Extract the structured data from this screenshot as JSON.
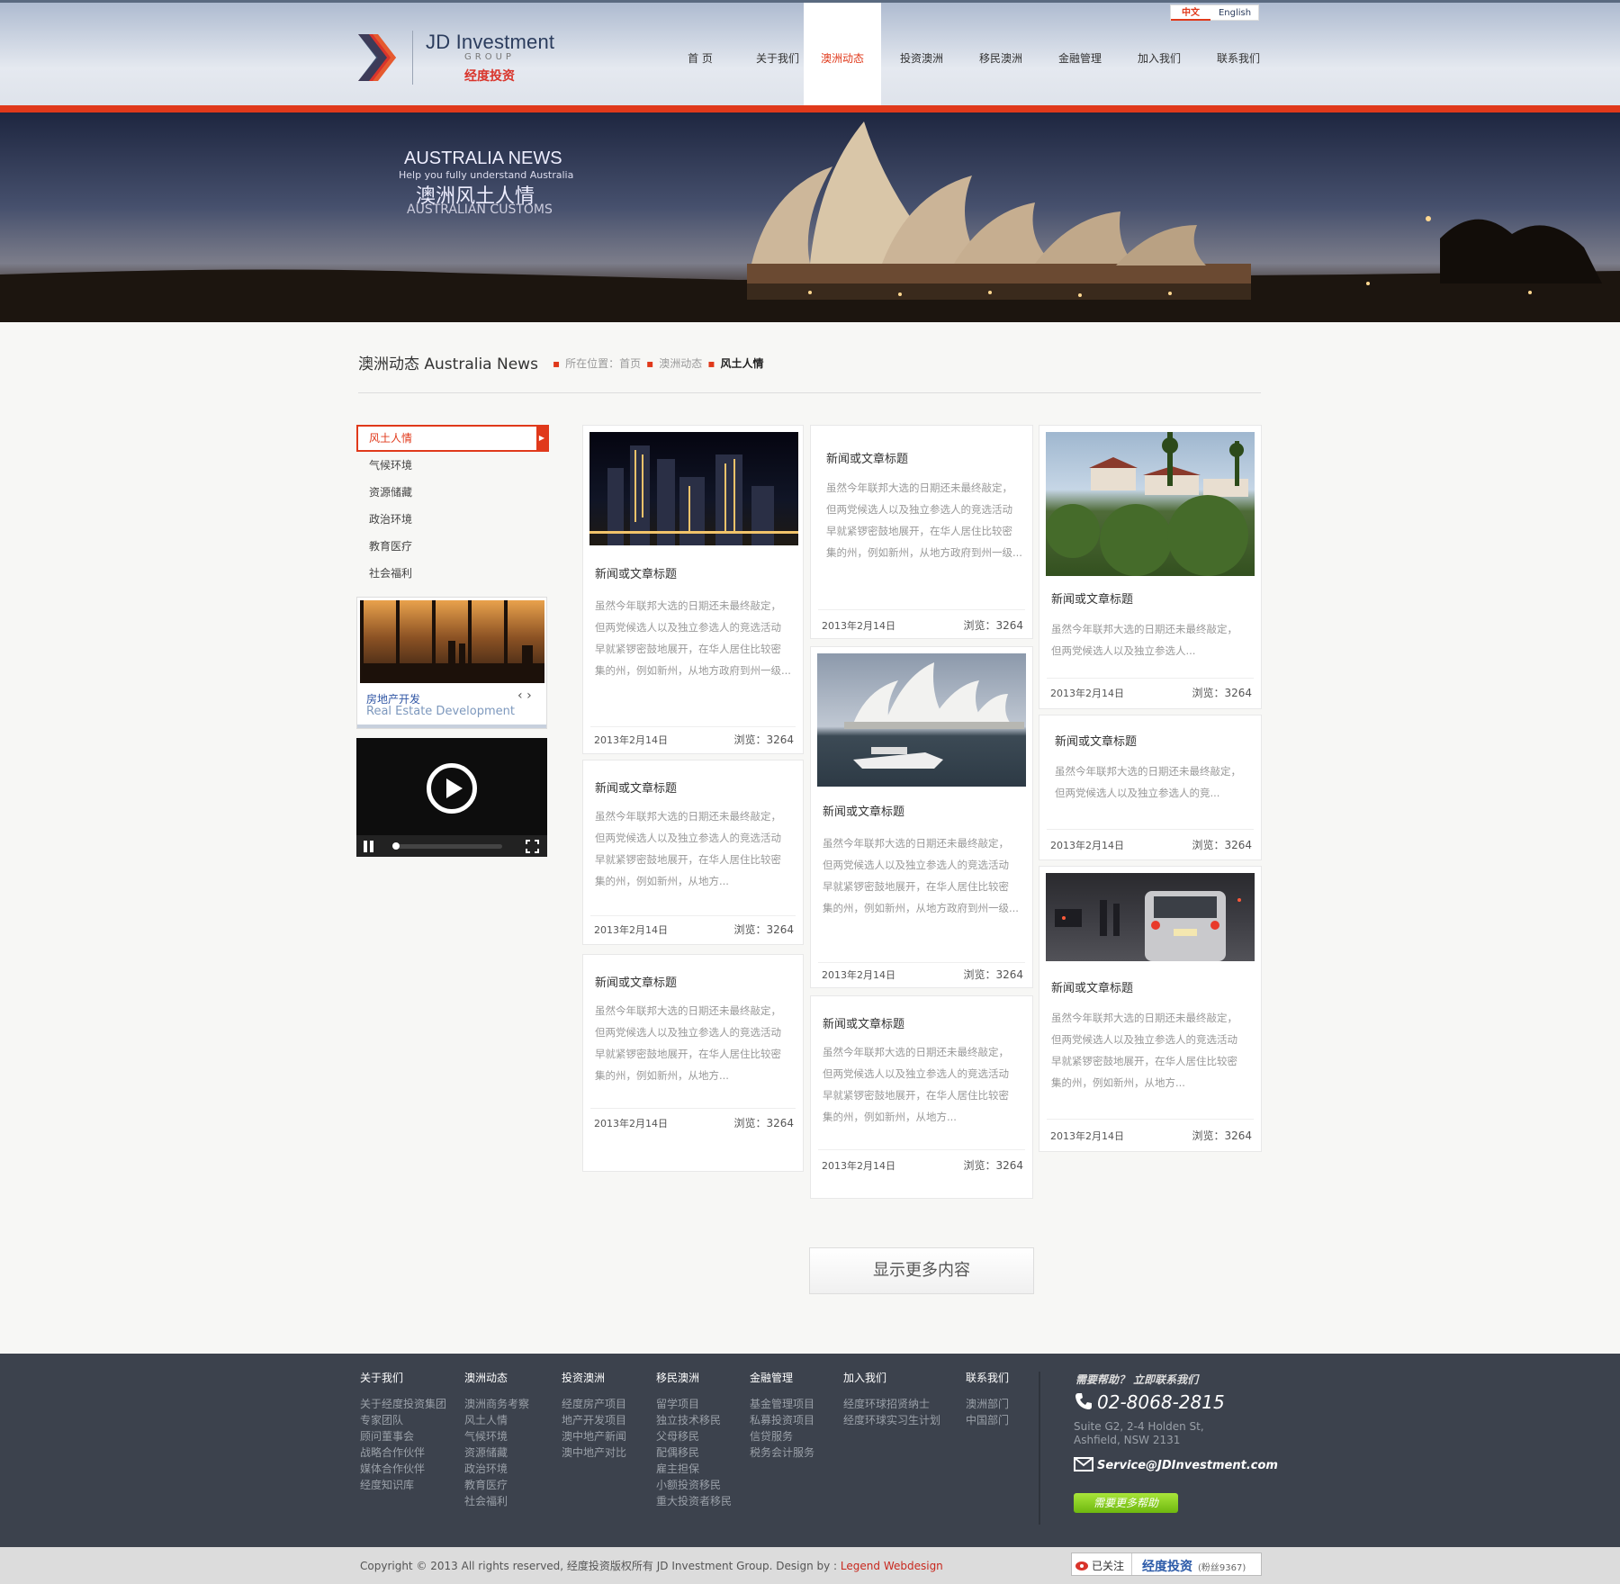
{
  "header": {
    "logo_name": "JD Investment",
    "logo_group": "GROUP",
    "logo_cn": "经度投资",
    "lang": [
      "中文",
      "English"
    ],
    "nav": [
      "首 页",
      "关于我们",
      "澳洲动态",
      "投资澳洲",
      "移民澳洲",
      "金融管理",
      "加入我们",
      "联系我们"
    ],
    "active_nav": "澳洲动态"
  },
  "banner": {
    "line1": "AUSTRALIA NEWS",
    "line2": "Help you fully understand Australia",
    "line3": "澳洲风土人情",
    "line4": "AUSTRALIAN CUSTOMS"
  },
  "page": {
    "title": "澳洲动态 Australia News",
    "crumb_prefix": "所在位置：首页",
    "crumb_mid": "澳洲动态",
    "crumb_current": "风土人情"
  },
  "sidebar": {
    "items": [
      "风土人情",
      "气候环境",
      "资源储藏",
      "政治环境",
      "教育医疗",
      "社会福利"
    ],
    "active": "风土人情",
    "promo_cn": "房地产开发",
    "promo_en": "Real Estate Development"
  },
  "cards": [
    {
      "title": "新闻或文章标题",
      "body": "虽然今年联邦大选的日期还未最终敲定，但两党候选人以及独立参选人的竞选活动早就紧锣密鼓地展开，在华人居住比较密集的州，例如新州，从地方政府到州一级...",
      "date": "2013年2月14日",
      "views": "浏览：3264"
    },
    {
      "title": "新闻或文章标题",
      "body": "虽然今年联邦大选的日期还未最终敲定，但两党候选人以及独立参选人的竞选活动早就紧锣密鼓地展开，在华人居住比较密集的州，例如新州，从地方...",
      "date": "2013年2月14日",
      "views": "浏览：3264"
    },
    {
      "title": "新闻或文章标题",
      "body": "虽然今年联邦大选的日期还未最终敲定，但两党候选人以及独立参选人的竞选活动早就紧锣密鼓地展开，在华人居住比较密集的州，例如新州，从地方...",
      "date": "2013年2月14日",
      "views": "浏览：3264"
    },
    {
      "title": "新闻或文章标题",
      "body": "虽然今年联邦大选的日期还未最终敲定，但两党候选人以及独立参选人的竞选活动早就紧锣密鼓地展开，在华人居住比较密集的州，例如新州，从地方政府到州一级...",
      "date": "2013年2月14日",
      "views": "浏览：3264"
    },
    {
      "title": "新闻或文章标题",
      "body": "虽然今年联邦大选的日期还未最终敲定，但两党候选人以及独立参选人的竞选活动早就紧锣密鼓地展开，在华人居住比较密集的州，例如新州，从地方政府到州一级...",
      "date": "2013年2月14日",
      "views": "浏览：3264"
    },
    {
      "title": "新闻或文章标题",
      "body": "虽然今年联邦大选的日期还未最终敲定，但两党候选人以及独立参选人的竞选活动早就紧锣密鼓地展开，在华人居住比较密集的州，例如新州，从地方...",
      "date": "2013年2月14日",
      "views": "浏览：3264"
    },
    {
      "title": "新闻或文章标题",
      "body": "虽然今年联邦大选的日期还未最终敲定，但两党候选人以及独立参选人...",
      "date": "2013年2月14日",
      "views": "浏览：3264"
    },
    {
      "title": "新闻或文章标题",
      "body": "虽然今年联邦大选的日期还未最终敲定，但两党候选人以及独立参选人的竞...",
      "date": "2013年2月14日",
      "views": "浏览：3264"
    },
    {
      "title": "新闻或文章标题",
      "body": "虽然今年联邦大选的日期还未最终敲定，但两党候选人以及独立参选人的竞选活动早就紧锣密鼓地展开，在华人居住比较密集的州，例如新州，从地方...",
      "date": "2013年2月14日",
      "views": "浏览：3264"
    }
  ],
  "more_button": "显示更多内容",
  "footer": {
    "columns": [
      {
        "heading": "关于我们",
        "links": [
          "关于经度投资集团",
          "专家团队",
          "顾问董事会",
          "战略合作伙伴",
          "媒体合作伙伴",
          "经度知识库"
        ]
      },
      {
        "heading": "澳洲动态",
        "links": [
          "澳洲商务考察",
          "风土人情",
          "气候环境",
          "资源储藏",
          "政治环境",
          "教育医疗",
          "社会福利"
        ]
      },
      {
        "heading": "投资澳洲",
        "links": [
          "经度房产项目",
          "地产开发项目",
          "澳中地产新闻",
          "澳中地产对比"
        ]
      },
      {
        "heading": "移民澳洲",
        "links": [
          "留学项目",
          "独立技术移民",
          "父母移民",
          "配偶移民",
          "雇主担保",
          "小额投资移民",
          "重大投资者移民"
        ]
      },
      {
        "heading": "金融管理",
        "links": [
          "基金管理项目",
          "私募投资项目",
          "信贷服务",
          "税务会计服务"
        ]
      },
      {
        "heading": "加入我们",
        "links": [
          "经度环球招贤纳士",
          "经度环球实习生计划"
        ]
      },
      {
        "heading": "联系我们",
        "links": [
          "澳洲部门",
          "中国部门"
        ]
      }
    ],
    "help_heading": "需要帮助？ 立即联系我们",
    "phone": "02-8068-2815",
    "address": "Suite G2, 2-4 Holden St, Ashfield, NSW 2131",
    "email": "Service@JDInvestment.com",
    "help_button": "需要更多帮助",
    "copyright": "Copyright © 2013 All rights reserved,  经度投资版权所有 JD Investment Group.  Design by : ",
    "designer": "Legend Webdesign",
    "weibo_follow": "已关注",
    "weibo_name": "经度投资",
    "weibo_fans": "(粉丝9367)"
  },
  "colors": {
    "accent": "#e0391b",
    "footer_bg": "#3c424d",
    "link_blue": "#2f55a4",
    "help_green": "#7cc61a"
  }
}
